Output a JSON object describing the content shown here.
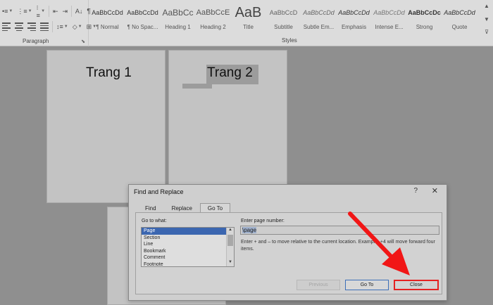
{
  "ribbon": {
    "paragraph_label": "Paragraph",
    "styles_label": "Styles",
    "paragraph_icons": {
      "row1": [
        "bullets-icon",
        "numbering-icon",
        "multilevel-list-icon",
        "decrease-indent-icon",
        "increase-indent-icon",
        "sort-icon",
        "pilcrow-icon"
      ],
      "row2": [
        "align-left-icon",
        "align-center-icon",
        "align-right-icon",
        "justify-icon",
        "line-spacing-icon",
        "shading-icon",
        "borders-icon"
      ]
    },
    "styles": [
      {
        "sample": "AaBbCcDd",
        "name": "¶ Normal"
      },
      {
        "sample": "AaBbCcDd",
        "name": "¶ No Spac..."
      },
      {
        "sample": "AaBbCc",
        "name": "Heading 1"
      },
      {
        "sample": "AaBbCcE",
        "name": "Heading 2"
      },
      {
        "sample": "AaB",
        "name": "Title"
      },
      {
        "sample": "AaBbCcD",
        "name": "Subtitle"
      },
      {
        "sample": "AaBbCcDd",
        "name": "Subtle Em..."
      },
      {
        "sample": "AaBbCcDd",
        "name": "Emphasis"
      },
      {
        "sample": "AaBbCcDd",
        "name": "Intense E..."
      },
      {
        "sample": "AaBbCcDc",
        "name": "Strong"
      },
      {
        "sample": "AaBbCcDd",
        "name": "Quote"
      }
    ]
  },
  "document": {
    "page1_text": "Trang 1",
    "page2_text": "Trang 2"
  },
  "dialog": {
    "title": "Find and Replace",
    "help": "?",
    "close_glyph": "✕",
    "tabs": [
      {
        "label": "Find",
        "active": false
      },
      {
        "label": "Replace",
        "active": false
      },
      {
        "label": "Go To",
        "active": true
      }
    ],
    "goto_label": "Go to what:",
    "goto_items": [
      "Page",
      "Section",
      "Line",
      "Bookmark",
      "Comment",
      "Footnote"
    ],
    "goto_selected": "Page",
    "page_number_label": "Enter page number:",
    "page_number_value": "\\page",
    "hint": "Enter + and – to move relative to the current location. Example: +4 will move forward four items.",
    "buttons": {
      "previous": "Previous",
      "goto": "Go To",
      "close": "Close"
    }
  },
  "colors": {
    "highlight_red": "#e52222",
    "selection_blue": "#3b66b0"
  }
}
